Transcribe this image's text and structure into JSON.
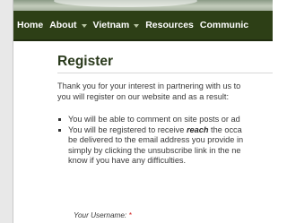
{
  "nav": {
    "items": [
      {
        "label": "Home",
        "has_dropdown": false
      },
      {
        "label": "About",
        "has_dropdown": true
      },
      {
        "label": "Vietnam",
        "has_dropdown": true
      },
      {
        "label": "Resources",
        "has_dropdown": false
      },
      {
        "label": "Communic",
        "has_dropdown": false
      }
    ]
  },
  "page": {
    "title": "Register",
    "intro_line1": "Thank you for your interest in partnering with us to",
    "intro_line2": "you will register on our website and as a result:"
  },
  "benefits": {
    "item1": "You will be able to comment on site posts or ad",
    "item2_pre": "You will be registered to receive ",
    "item2_em": "reach",
    "item2_post": " the occa",
    "item2_line2": "be delivered to the email address you provide in",
    "item2_line3": "simply by clicking the unsubscribe link in the ne",
    "item2_line4": "know if you have any difficulties."
  },
  "form": {
    "username_label": "Your Username:",
    "required_marker": "*"
  },
  "colors": {
    "nav_bg": "#2d3f16",
    "title": "#2a3a1c",
    "required": "#d02020"
  }
}
